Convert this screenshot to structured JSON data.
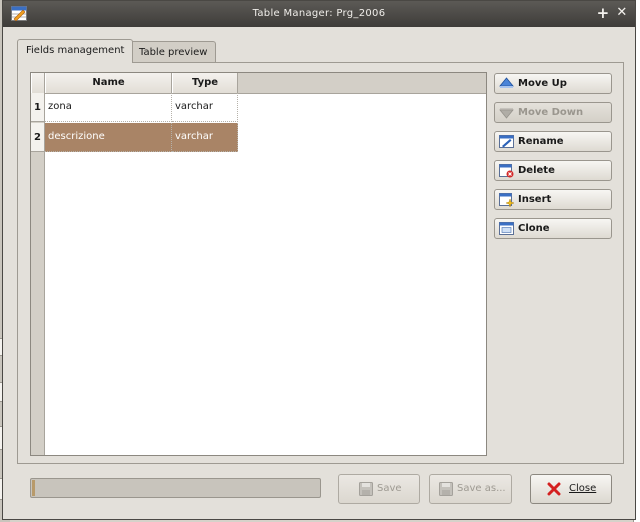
{
  "window": {
    "title": "Table Manager: Prg_2006",
    "icons": {
      "app": "table-manager-app-icon",
      "maximize": "plus-icon",
      "close": "close-x-icon"
    },
    "maximize_glyph": "+",
    "close_glyph": "✕"
  },
  "tabs": [
    {
      "label": "Fields management",
      "active": true
    },
    {
      "label": "Table preview",
      "active": false
    }
  ],
  "table": {
    "columns": [
      "Name",
      "Type"
    ],
    "rows": [
      {
        "num": "1",
        "name": "zona",
        "type": "varchar",
        "selected": false
      },
      {
        "num": "2",
        "name": "descrizione",
        "type": "varchar",
        "selected": true
      }
    ]
  },
  "side_buttons": [
    {
      "label": "Move Up",
      "icon": "arrow-up-icon",
      "enabled": true
    },
    {
      "label": "Move Down",
      "icon": "arrow-down-icon",
      "enabled": false
    },
    {
      "label": "Rename",
      "icon": "rename-icon",
      "enabled": true
    },
    {
      "label": "Delete",
      "icon": "delete-icon",
      "enabled": true
    },
    {
      "label": "Insert",
      "icon": "insert-icon",
      "enabled": true
    },
    {
      "label": "Clone",
      "icon": "clone-icon",
      "enabled": true
    }
  ],
  "bottom": {
    "progress": 0.01,
    "save": {
      "label": "Save",
      "enabled": false,
      "icon": "save-disk-icon"
    },
    "save_as": {
      "label": "Save as...",
      "enabled": false,
      "icon": "save-disk-icon"
    },
    "close": {
      "label": "Close",
      "enabled": true,
      "icon": "close-red-x-icon"
    }
  },
  "colors": {
    "selection": "#a98466",
    "titlebar": "#4a4844",
    "window_bg": "#e3e0da"
  }
}
